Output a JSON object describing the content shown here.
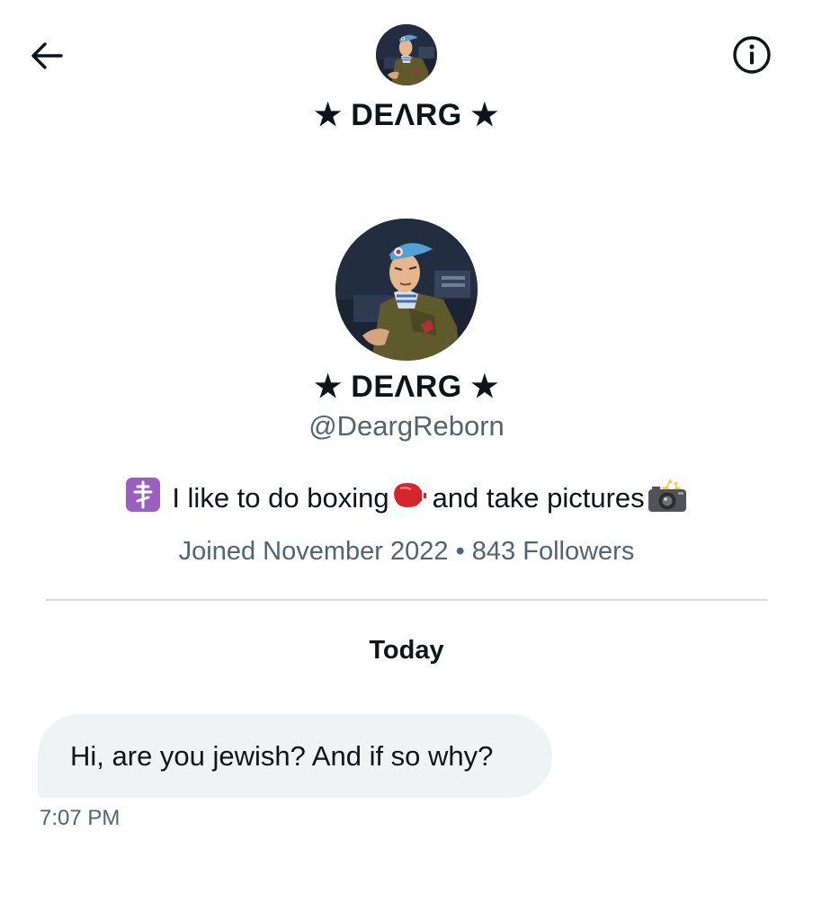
{
  "header": {
    "back_icon": "arrow-left-icon",
    "info_icon": "info-circle-icon",
    "title": "★ DEΛRG ★"
  },
  "profile": {
    "display_name": "★ DEΛRG ★",
    "handle": "@DeargReborn",
    "bio": {
      "cross_icon": "orthodox-cross-emoji",
      "text_1": "I like to do boxing",
      "glove_icon": "boxing-glove-emoji",
      "text_2": "and take pictures",
      "camera_icon": "camera-with-flash-emoji"
    },
    "joined": "Joined November 2022",
    "separator": "•",
    "followers": "843 Followers"
  },
  "conversation": {
    "date_label": "Today",
    "messages": [
      {
        "text": "Hi, are you jewish? And if so why?",
        "time": "7:07 PM"
      }
    ]
  },
  "colors": {
    "text_primary": "#0f1419",
    "text_secondary": "#536471",
    "bubble_bg": "#eff3f4",
    "divider": "#d7dbdc"
  }
}
